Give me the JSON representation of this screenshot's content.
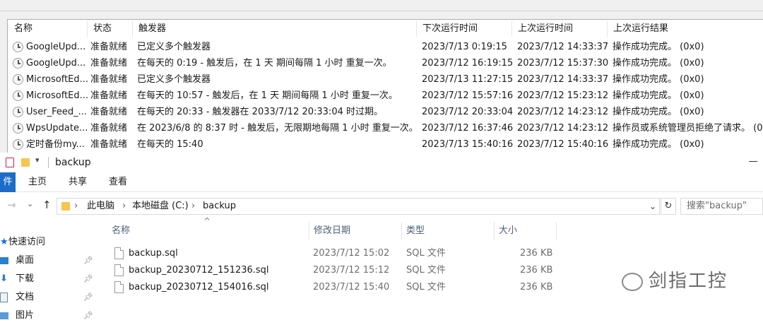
{
  "scheduler": {
    "columns": [
      "名称",
      "状态",
      "触发器",
      "下次运行时间",
      "上次运行时间",
      "上次运行结果"
    ],
    "rows": [
      {
        "name": "GoogleUpd...",
        "status": "准备就绪",
        "trigger": "已定义多个触发器",
        "next": "2023/7/13 0:19:15",
        "last": "2023/7/12 14:33:37",
        "result": "操作成功完成。 (0x0)"
      },
      {
        "name": "GoogleUpd...",
        "status": "准备就绪",
        "trigger": "在每天的 0:19 - 触发后，在 1 天 期间每隔 1 小时 重复一次。",
        "next": "2023/7/12 16:19:15",
        "last": "2023/7/12 15:37:30",
        "result": "操作成功完成。 (0x0)"
      },
      {
        "name": "MicrosoftEd...",
        "status": "准备就绪",
        "trigger": "已定义多个触发器",
        "next": "2023/7/13 11:27:15",
        "last": "2023/7/12 14:33:37",
        "result": "操作成功完成。 (0x0)"
      },
      {
        "name": "MicrosoftEd...",
        "status": "准备就绪",
        "trigger": "在每天的 10:57 - 触发后，在 1 天 期间每隔 1 小时 重复一次。",
        "next": "2023/7/12 15:57:16",
        "last": "2023/7/12 15:23:12",
        "result": "操作成功完成。 (0x0)"
      },
      {
        "name": "User_Feed_...",
        "status": "准备就绪",
        "trigger": "在每天的 20:33 - 触发器在 2033/7/12 20:33:04 时过期。",
        "next": "2023/7/12 20:33:04",
        "last": "2023/7/12 14:23:12",
        "result": "操作成功完成。 (0x0)"
      },
      {
        "name": "WpsUpdate...",
        "status": "准备就绪",
        "trigger": "在 2023/6/8 的 8:37 时 - 触发后，无限期地每隔 1 小时 重复一次。",
        "next": "2023/7/12 16:37:46",
        "last": "2023/7/12 14:23:12",
        "result": "操作员或系统管理员拒绝了请求。 (0"
      },
      {
        "name": "定时备份my...",
        "status": "准备就绪",
        "trigger": "在每天的 15:40",
        "next": "2023/7/13 15:40:16",
        "last": "2023/7/12 15:40:16",
        "result": "操作成功完成。 (0x0)"
      }
    ]
  },
  "explorer": {
    "window_title": "backup",
    "ribbon_tabs": [
      "件",
      "主页",
      "共享",
      "查看"
    ],
    "breadcrumb": [
      "此电脑",
      "本地磁盘 (C:)",
      "backup"
    ],
    "search_placeholder": "搜索\"backup\"",
    "nav_items": [
      "快速访问",
      "桌面",
      "下载",
      "文档",
      "图片"
    ],
    "columns": [
      "名称",
      "修改日期",
      "类型",
      "大小"
    ],
    "files": [
      {
        "name": "backup.sql",
        "date": "2023/7/12 15:02",
        "type": "SQL 文件",
        "size": "236 KB"
      },
      {
        "name": "backup_20230712_151236.sql",
        "date": "2023/7/12 15:12",
        "type": "SQL 文件",
        "size": "236 KB"
      },
      {
        "name": "backup_20230712_154016.sql",
        "date": "2023/7/12 15:40",
        "type": "SQL 文件",
        "size": "236 KB"
      }
    ]
  },
  "watermark": "剑指工控"
}
